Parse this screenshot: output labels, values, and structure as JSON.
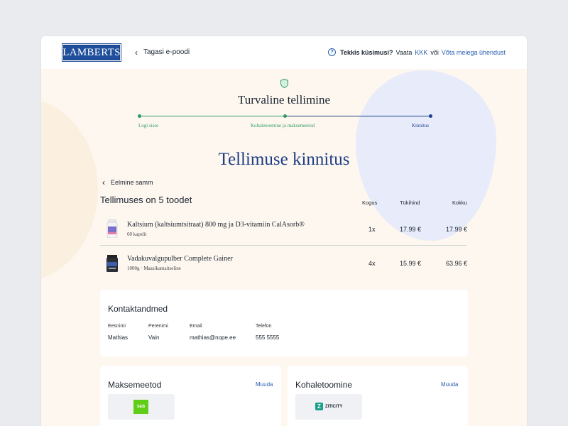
{
  "header": {
    "logo_text": "LAMBERTS",
    "back_label": "Tagasi e-poodi",
    "help_question": "Tekkis küsimusi?",
    "help_see": "Vaata",
    "faq_link": "KKK",
    "or": "või",
    "contact_link": "Võta meiega ühendust"
  },
  "checkout": {
    "secure_title": "Turvaline tellimine",
    "steps": [
      "Logi sisse",
      "Kohaletoomine ja maksemeetod",
      "Kinnitus"
    ],
    "page_title": "Tellimuse kinnitus",
    "prev_step": "Eelmine samm"
  },
  "order": {
    "heading": "Tellimuses on 5 toodet",
    "columns": {
      "qty": "Kogus",
      "unit": "Tükihind",
      "total": "Kokku"
    },
    "items": [
      {
        "name": "Kaltsium (kaltsiumtsitraat) 800 mg ja D3-vitamiin CalAsorb®",
        "sub": "60 kapslit",
        "qty": "1x",
        "unit_price": "17.99 €",
        "total": "17.99 €",
        "thumb": "bottle-icon"
      },
      {
        "name": "Vadakuvalgupulber Complete Gainer",
        "sub": "1000g · Maasikamaitseline",
        "qty": "4x",
        "unit_price": "15.99 €",
        "total": "63.96 €",
        "thumb": "tub-icon"
      }
    ]
  },
  "contact": {
    "title": "Kontaktandmed",
    "fields": [
      {
        "label": "Eesnimi",
        "value": "Mathias"
      },
      {
        "label": "Perenimi",
        "value": "Vain"
      },
      {
        "label": "Email",
        "value": "mathias@nope.ee"
      },
      {
        "label": "Telefon",
        "value": "555 5555"
      }
    ]
  },
  "payment": {
    "title": "Maksemeetod",
    "edit": "Muuda",
    "method_logo": "SEB"
  },
  "shipping": {
    "title": "Kohaletoomine",
    "edit": "Muuda",
    "method_logo": "ZITICITY"
  },
  "colors": {
    "brand": "#1f4f9c",
    "accent_green": "#2e9b62",
    "link": "#2a5db0",
    "hero_bg": "#fdf7ef"
  }
}
